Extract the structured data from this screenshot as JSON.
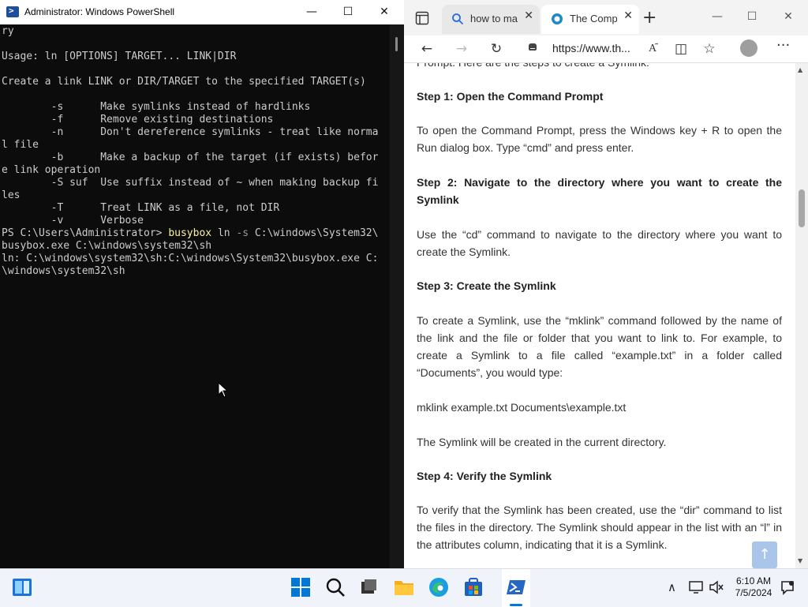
{
  "powershell": {
    "title": "Administrator: Windows PowerShell",
    "controls": {
      "minimize": "—",
      "maximize": "☐",
      "close": "✕"
    },
    "lines": [
      "ry",
      "",
      "Usage: ln [OPTIONS] TARGET... LINK|DIR",
      "",
      "Create a link LINK or DIR/TARGET to the specified TARGET(s)",
      "",
      "        -s      Make symlinks instead of hardlinks",
      "        -f      Remove existing destinations",
      "        -n      Don't dereference symlinks - treat like norma",
      "l file",
      "        -b      Make a backup of the target (if exists) befor",
      "e link operation",
      "        -S suf  Use suffix instead of ~ when making backup fi",
      "les",
      "        -T      Treat LINK as a file, not DIR",
      "        -v      Verbose"
    ],
    "prompt": "PS C:\\Users\\Administrator> ",
    "cmd_name": "busybox",
    "cmd_args_1": " ln ",
    "cmd_flag": "-s",
    "cmd_args_2": " C:\\windows\\System32\\",
    "cmd_line_2": "busybox.exe C:\\windows\\system32\\sh",
    "out_line_1": "ln: C:\\windows\\system32\\sh:C:\\windows\\System32\\busybox.exe C:",
    "out_line_2": "\\windows\\system32\\sh"
  },
  "edge": {
    "tabs": [
      {
        "label": "how to ma",
        "icon": "search-icon"
      },
      {
        "label": "The Compl",
        "icon": "site-favicon"
      }
    ],
    "new_tab": "+",
    "controls": {
      "minimize": "—",
      "maximize": "☐",
      "close": "✕"
    },
    "url": "https://www.th...",
    "toolbar_icons": [
      "back-icon",
      "forward-icon",
      "refresh-icon",
      "lock-icon",
      "read-aloud-icon",
      "split-screen-icon",
      "favorites-icon",
      "profile-icon",
      "more-icon"
    ],
    "more_label": "···",
    "article": {
      "partial_top": "Prompt. Here are the steps to create a Symlink:",
      "step1_heading": "Step 1: Open the Command Prompt",
      "step1_text": "To open the Command Prompt, press the Windows key + R to open the Run dialog box. Type “cmd” and press enter.",
      "step2_heading": "Step 2: Navigate to the directory where you want to create the Symlink",
      "step2_text": "Use the “cd” command to navigate to the directory where you want to create the Symlink.",
      "step3_heading": "Step 3: Create the Symlink",
      "step3_text": "To create a Symlink, use the “mklink” command followed by the name of the link and the file or folder that you want to link to. For example, to create a Symlink to a file called “example.txt” in a folder called “Documents”, you would type:",
      "step3_code": "mklink example.txt Documents\\example.txt",
      "step3_result": "The Symlink will be created in the current directory.",
      "step4_heading": "Step 4: Verify the Symlink",
      "step4_text": "To verify that the Symlink has been created, use the “dir” command to list the files in the directory. The Symlink should appear in the list with an “l” in the attributes column, indicating that it is a Symlink."
    },
    "to_top": "↑"
  },
  "taskbar": {
    "time": "6:10 AM",
    "date": "7/5/2024",
    "pinned": [
      "widgets-icon",
      "start-icon",
      "search-icon",
      "task-view-icon",
      "file-explorer-icon",
      "edge-icon",
      "store-icon",
      "powershell-icon"
    ],
    "tray_chevron": "∧"
  },
  "colors": {
    "console_bg": "#0c0c0c",
    "console_text": "#cccccc",
    "console_command": "#f9f1a5",
    "windows_blue": "#0078d4"
  }
}
